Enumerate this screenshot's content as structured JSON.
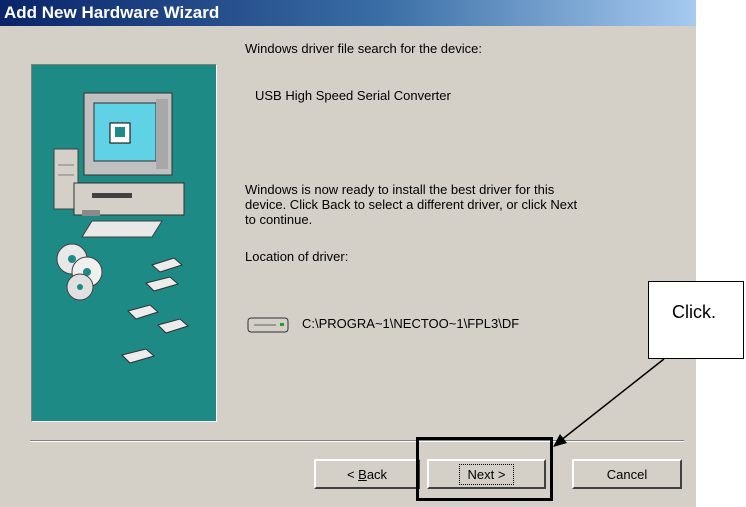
{
  "window": {
    "title": "Add New Hardware Wizard"
  },
  "content": {
    "search_heading": "Windows driver file search for the device:",
    "device_name": "USB High Speed Serial Converter",
    "ready_line1": "Windows is now ready to install the best driver for this",
    "ready_line2": "device. Click Back to select a different driver, or click Next",
    "ready_line3": "to continue.",
    "location_label": "Location of driver:",
    "driver_path": "C:\\PROGRA~1\\NECTOO~1\\FPL3\\DF"
  },
  "buttons": {
    "back_prefix": "< ",
    "back_mnemonic": "B",
    "back_rest": "ack",
    "next_label": "Next >",
    "cancel_label": "Cancel"
  },
  "annotation": {
    "callout_text": "Click."
  },
  "icons": [
    "computer-icon",
    "cd-disc-icon",
    "floppy-disk-icon",
    "drive-icon"
  ],
  "colors": {
    "dialog_bg": "#d4d0c8",
    "titlebar_start": "#0a246a",
    "titlebar_end": "#a6caf0",
    "art_teal": "#1e8a86"
  }
}
